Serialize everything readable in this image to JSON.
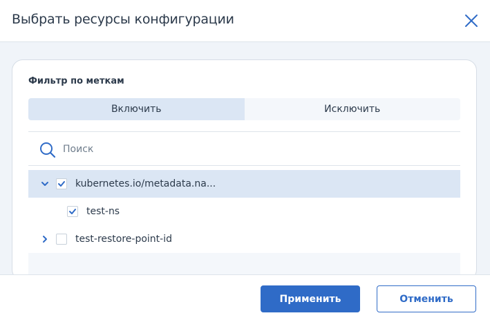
{
  "dialog": {
    "title": "Выбрать ресурсы конфигурации",
    "close_icon": "close-icon"
  },
  "filter": {
    "title": "Фильтр по меткам",
    "tabs": [
      {
        "label": "Включить",
        "active": true
      },
      {
        "label": "Исключить",
        "active": false
      }
    ]
  },
  "search": {
    "placeholder": "Поиск",
    "value": "",
    "icon": "search-icon"
  },
  "tree": {
    "items": [
      {
        "label": "kubernetes.io/metadata.na...",
        "checked": true,
        "expanded": true,
        "level": 0
      },
      {
        "label": "test-ns",
        "checked": true,
        "level": 1
      },
      {
        "label": "test-restore-point-id",
        "checked": false,
        "expanded": false,
        "level": 0
      }
    ]
  },
  "footer": {
    "apply_label": "Применить",
    "cancel_label": "Отменить"
  },
  "colors": {
    "accent": "#2f6bc7",
    "selected_row": "#dbe6f4",
    "background": "#f0f4f9"
  }
}
